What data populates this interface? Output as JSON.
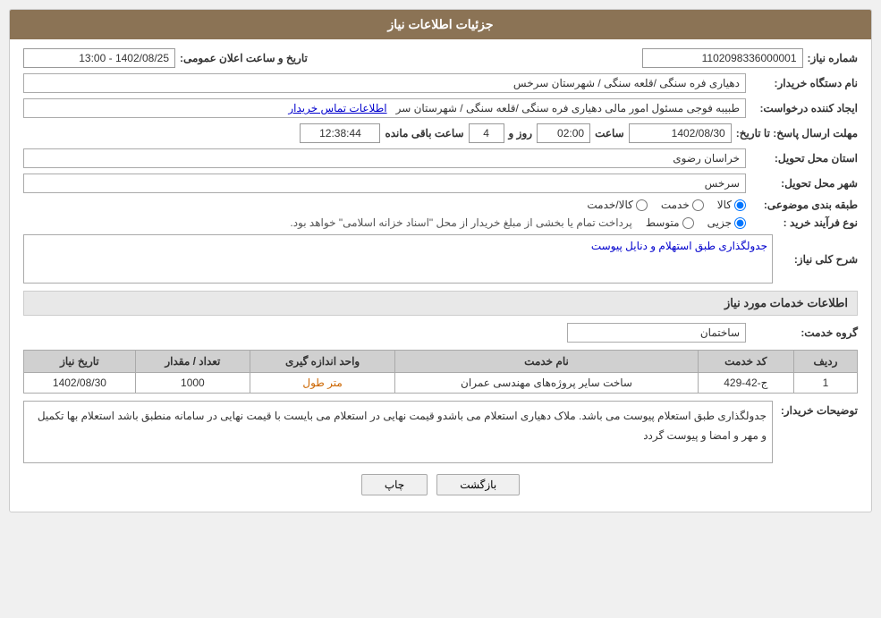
{
  "header": {
    "title": "جزئیات اطلاعات نیاز"
  },
  "fields": {
    "need_number_label": "شماره نیاز:",
    "need_number_value": "1102098336000001",
    "buyer_org_label": "نام دستگاه خریدار:",
    "buyer_org_value": "دهیاری فره سنگی /قلعه سنگی / شهرستان سرخس",
    "date_label": "تاریخ و ساعت اعلان عمومی:",
    "date_value": "1402/08/25 - 13:00",
    "creator_label": "ایجاد کننده درخواست:",
    "creator_value": "طبیبه فوجی مسئول امور مالی دهیاری فره سنگی /قلعه سنگی / شهرستان سر",
    "contact_link": "اطلاعات تماس خریدار",
    "deadline_label": "مهلت ارسال پاسخ: تا تاریخ:",
    "deadline_date": "1402/08/30",
    "deadline_time": "02:00",
    "deadline_days": "4",
    "deadline_remaining": "12:38:44",
    "deadline_remaining_label": "ساعت باقی مانده",
    "deadline_days_label": "روز و",
    "deadline_time_label": "ساعت",
    "province_label": "استان محل تحویل:",
    "province_value": "خراسان رضوی",
    "city_label": "شهر محل تحویل:",
    "city_value": "سرخس",
    "category_label": "طبقه بندی موضوعی:",
    "category_kala": "کالا",
    "category_khedmat": "خدمت",
    "category_kala_khedmat": "کالا/خدمت",
    "purchase_type_label": "نوع فرآیند خرید :",
    "purchase_type_jozei": "جزیی",
    "purchase_type_mottaset": "متوسط",
    "purchase_type_desc": "پرداخت تمام یا بخشی از مبلغ خریدار از محل \"اسناد خزانه اسلامی\" خواهد بود.",
    "description_label": "شرح کلی نیاز:",
    "description_value": "جدولگذاری طبق استهلام و دنایل پیوست",
    "services_section_label": "اطلاعات خدمات مورد نیاز",
    "service_group_label": "گروه خدمت:",
    "service_group_value": "ساختمان",
    "table": {
      "headers": [
        "ردیف",
        "کد خدمت",
        "نام خدمت",
        "واحد اندازه گیری",
        "تعداد / مقدار",
        "تاریخ نیاز"
      ],
      "rows": [
        {
          "row": "1",
          "code": "ج-42-429",
          "name": "ساخت سایر پروژه‌های مهندسی عمران",
          "unit": "متر طول",
          "quantity": "1000",
          "date": "1402/08/30"
        }
      ]
    },
    "buyer_notes_label": "توضیحات خریدار:",
    "buyer_notes_value": "جدولگذاری طبق استعلام  پیوست می باشد. ملاک  دهیاری استعلام  می باشدو قیمت نهایی در استعلام می بایست با قیمت  نهایی در سامانه  منطبق باشد استعلام  بها  تکمیل  و مهر و امضا و پیوست  گردد",
    "back_button": "بازگشت",
    "print_button": "چاپ"
  }
}
